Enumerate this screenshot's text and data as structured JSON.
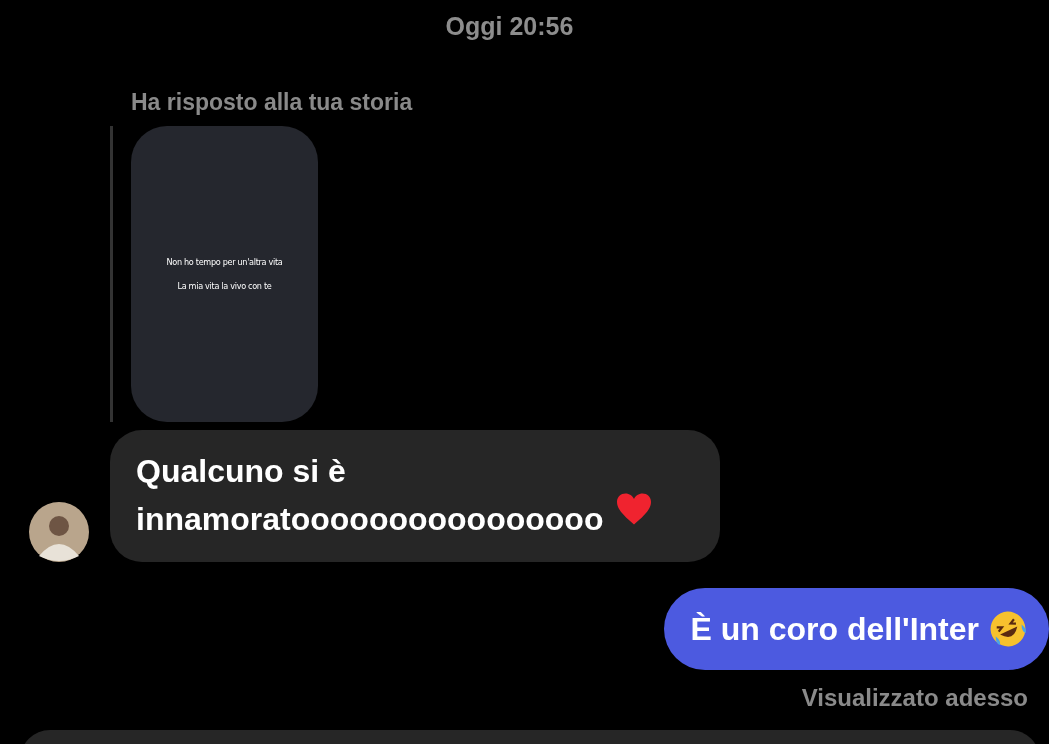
{
  "timestamp": "Oggi 20:56",
  "story_reply": {
    "label": "Ha risposto alla tua storia",
    "story_lines": [
      "Non ho tempo per un'altra vita",
      "La mia vita la vivo con te"
    ]
  },
  "messages": [
    {
      "kind": "incoming",
      "text": "Qualcuno si è innamoratoooooooooooooooo",
      "emoji": {
        "kind": "heart"
      }
    },
    {
      "kind": "outgoing",
      "text": "È un coro dell'Inter",
      "emoji": {
        "kind": "laughing"
      }
    }
  ],
  "seen_status": "Visualizzato adesso"
}
